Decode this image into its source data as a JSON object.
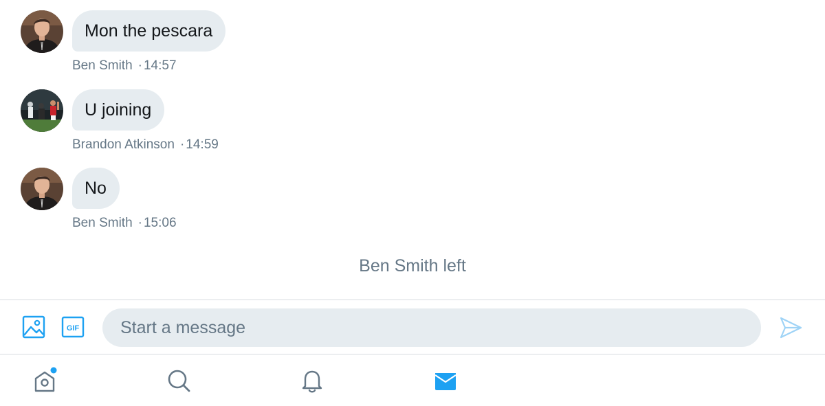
{
  "conversation": {
    "messages": [
      {
        "text": "Mon the pescara",
        "sender": "Ben Smith",
        "separator": "·",
        "time": "14:57",
        "avatar": "ben-smith-avatar"
      },
      {
        "text": "U joining",
        "sender": "Brandon Atkinson",
        "separator": "·",
        "time": "14:59",
        "avatar": "brandon-atkinson-avatar"
      },
      {
        "text": "No",
        "sender": "Ben Smith",
        "separator": "·",
        "time": "15:06",
        "avatar": "ben-smith-avatar"
      }
    ],
    "system_note": "Ben Smith left"
  },
  "composer": {
    "placeholder": "Start a message",
    "value": "",
    "image_button_icon": "image-icon",
    "gif_button_label": "GIF",
    "send_button_icon": "send-icon"
  },
  "tabbar": {
    "tabs": [
      {
        "icon": "home-icon",
        "has_notification_dot": true,
        "active": false
      },
      {
        "icon": "search-icon",
        "active": false
      },
      {
        "icon": "bell-icon",
        "active": false
      },
      {
        "icon": "mail-icon",
        "active": true
      }
    ]
  },
  "colors": {
    "accent": "#1da1f2",
    "bubble_bg": "#e6ecf0",
    "text_primary": "#14171a",
    "text_secondary": "#657786",
    "divider": "#d6dbdf",
    "icon_inactive": "#657786"
  }
}
